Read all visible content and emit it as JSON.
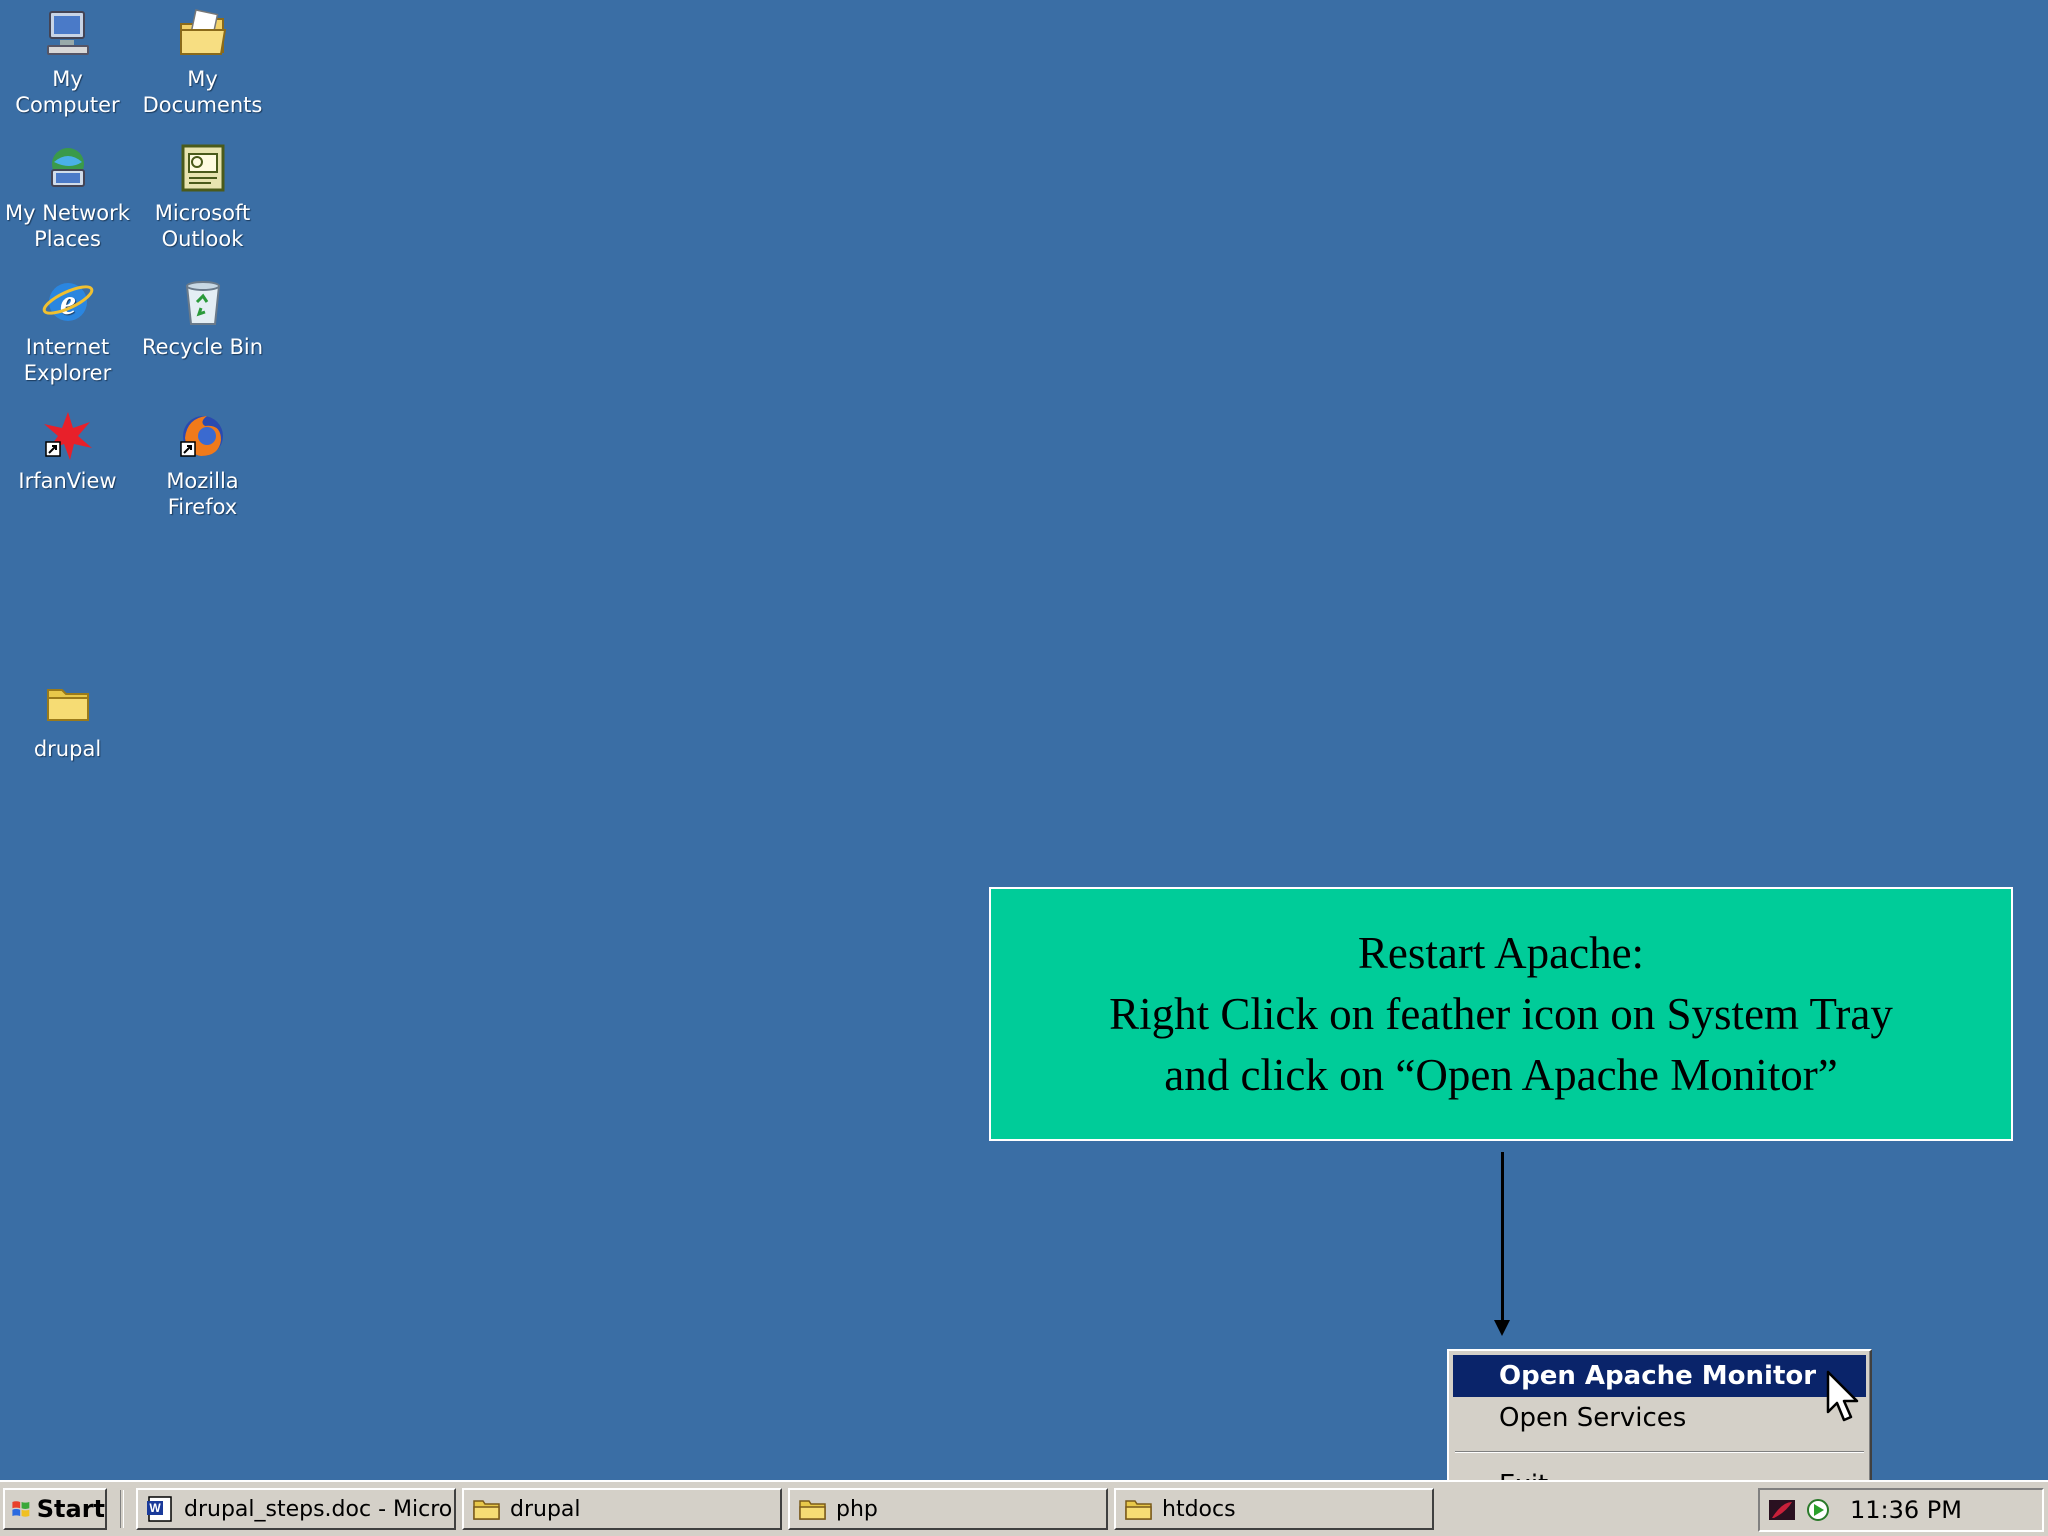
{
  "desktop": {
    "icons": [
      {
        "label": "My Computer",
        "icon": "my-computer-icon"
      },
      {
        "label": "My Documents",
        "icon": "my-documents-icon"
      },
      {
        "label": "My Network Places",
        "icon": "network-places-icon"
      },
      {
        "label": "Microsoft Outlook",
        "icon": "outlook-icon"
      },
      {
        "label": "Internet Explorer",
        "icon": "internet-explorer-icon"
      },
      {
        "label": "Recycle Bin",
        "icon": "recycle-bin-icon"
      },
      {
        "label": "IrfanView",
        "icon": "irfanview-icon"
      },
      {
        "label": "Mozilla Firefox",
        "icon": "firefox-icon"
      },
      {
        "label": "drupal",
        "icon": "folder-icon"
      }
    ],
    "background_color": "#3a6ea5"
  },
  "callout": {
    "line1": "Restart Apache:",
    "line2": "Right Click on feather icon on System Tray",
    "line3": "and click on “Open Apache Monitor”",
    "background_color": "#00cc99"
  },
  "context_menu": {
    "items": [
      {
        "label": "Open Apache Monitor",
        "active": true
      },
      {
        "label": "Open Services",
        "active": false
      },
      {
        "label": "Exit",
        "active": false
      }
    ]
  },
  "taskbar": {
    "start_label": "Start",
    "buttons": [
      {
        "label": "drupal_steps.doc - Micro...",
        "icon": "word-document-icon"
      },
      {
        "label": "drupal",
        "icon": "folder-icon"
      },
      {
        "label": "php",
        "icon": "folder-icon"
      },
      {
        "label": "htdocs",
        "icon": "folder-icon"
      }
    ],
    "tray": {
      "icons": [
        "apache-feather-icon",
        "apache-monitor-icon"
      ],
      "clock": "11:36 PM"
    }
  }
}
